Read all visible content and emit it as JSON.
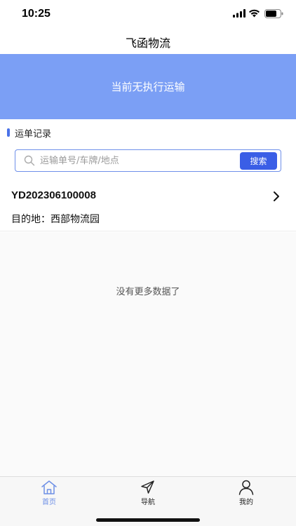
{
  "status_bar": {
    "time": "10:25"
  },
  "header": {
    "title": "飞函物流"
  },
  "banner": {
    "text": "当前无执行运输"
  },
  "section": {
    "title": "运单记录"
  },
  "search": {
    "placeholder": "运输单号/车牌/地点",
    "value": "",
    "button_label": "搜索"
  },
  "orders": [
    {
      "id": "YD202306100008",
      "destination": "目的地：西部物流园"
    }
  ],
  "list_footer": "没有更多数据了",
  "tabs": [
    {
      "label": "首页",
      "icon": "home-icon",
      "active": true
    },
    {
      "label": "导航",
      "icon": "navigation-arrow-icon",
      "active": false
    },
    {
      "label": "我的",
      "icon": "user-icon",
      "active": false
    }
  ],
  "colors": {
    "accent": "#3a5ee6",
    "banner": "#7b9ff5",
    "active_tab": "#6d8fe6"
  }
}
